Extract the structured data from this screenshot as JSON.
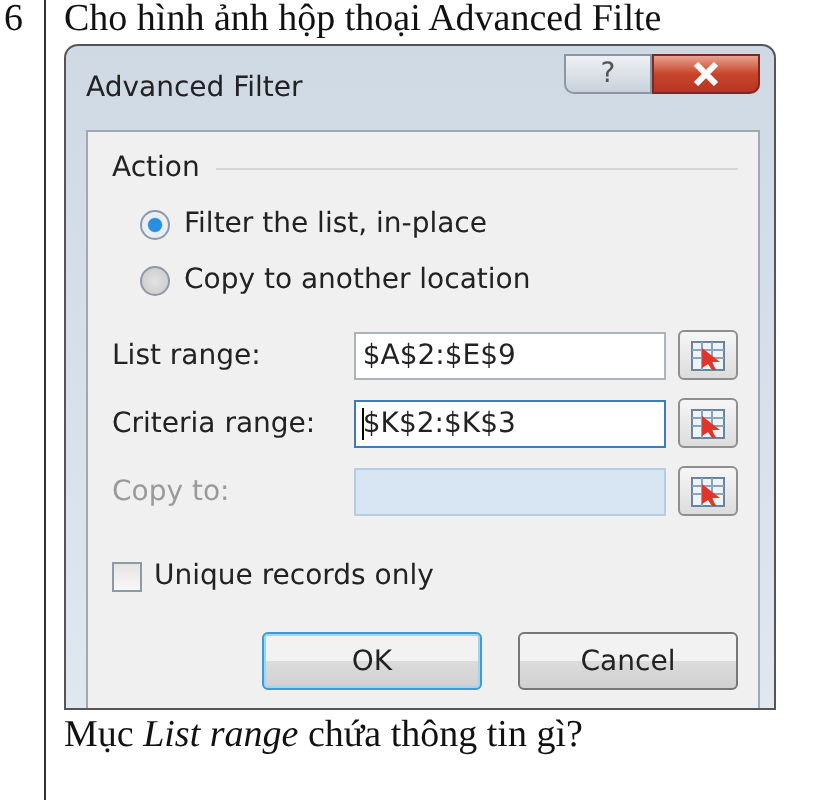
{
  "document": {
    "number": "6",
    "heading": "Cho hình ảnh hộp thoại Advanced Filte",
    "question": "Mục *List range* chứa thông tin gì?"
  },
  "dialog": {
    "title": "Advanced Filter",
    "help_label": "?",
    "group_label": "Action",
    "options": [
      {
        "label": "Filter the list, in-place",
        "selected": true
      },
      {
        "label": "Copy to another location",
        "selected": false
      }
    ],
    "fields": [
      {
        "label": "List range:",
        "value": "$A$2:$E$9",
        "disabled": false,
        "focused": false
      },
      {
        "label": "Criteria range:",
        "value": "$K$2:$K$3",
        "disabled": false,
        "focused": true
      },
      {
        "label": "Copy to:",
        "disabled": true,
        "focused": false
      }
    ],
    "checkbox": {
      "label": "Unique records only",
      "checked": false
    },
    "buttons": [
      {
        "label": "OK",
        "default": true
      },
      {
        "label": "Cancel",
        "default": false
      }
    ]
  }
}
